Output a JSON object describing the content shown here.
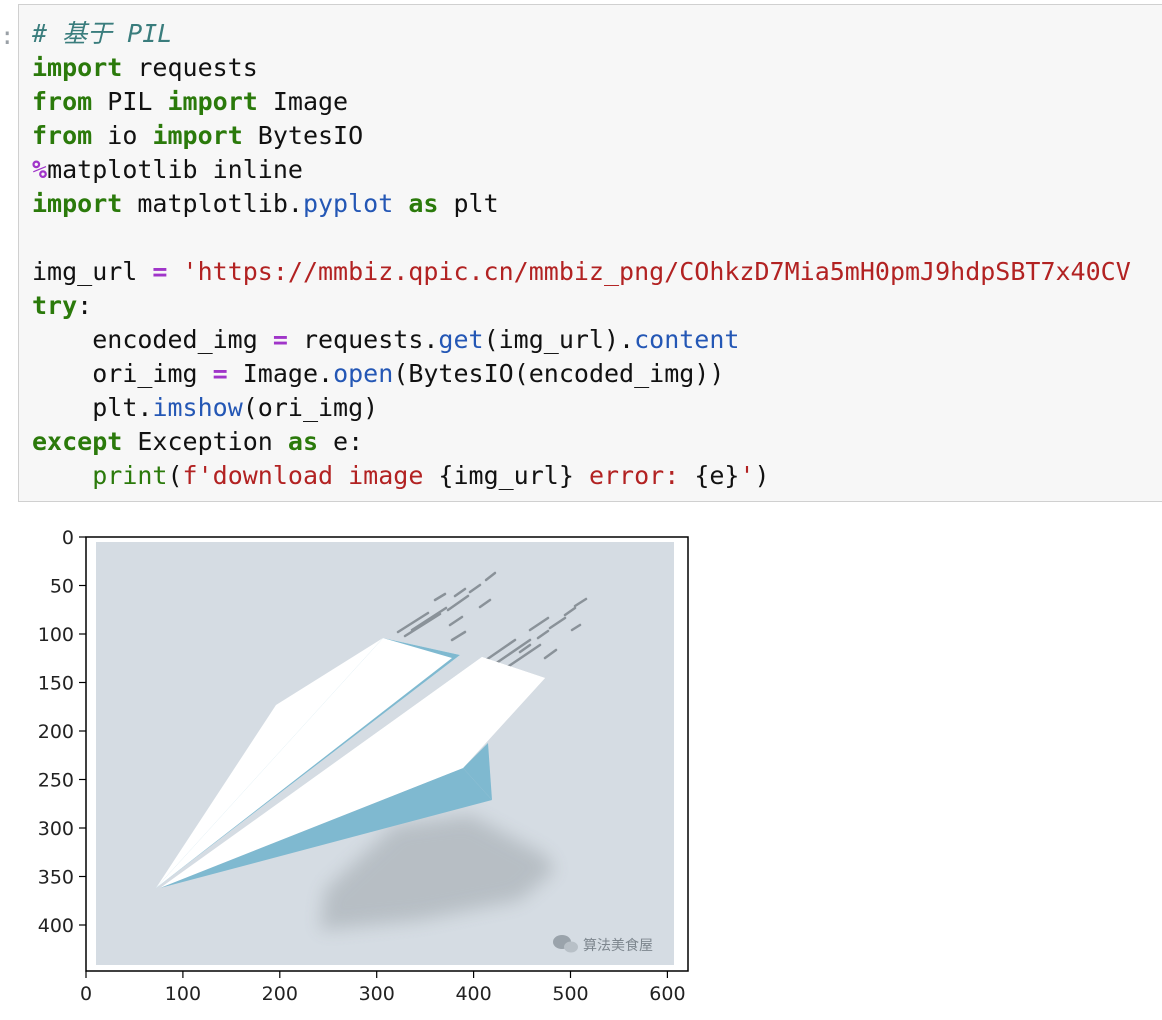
{
  "cell": {
    "prompt": ":",
    "code": {
      "comment": "# 基于 PIL",
      "kw_import": "import",
      "kw_from": "from",
      "kw_as": "as",
      "kw_try": "try",
      "kw_except": "except",
      "requests": " requests",
      "pil_mod": " PIL ",
      "image_cls": " Image",
      "io_mod": " io ",
      "bytesio": " BytesIO",
      "magic_sym": "%",
      "magic_rest": "matplotlib inline",
      "mpl_mod": " matplotlib.",
      "pyplot": "pyplot",
      "plt": " plt",
      "img_url_var": "img_url ",
      "eq": "=",
      "url_str": " 'https://mmbiz.qpic.cn/mmbiz_png/COhkzD7Mia5mH0pmJ9hdpSBT7x40CV",
      "colon": ":",
      "indent": "    ",
      "encoded_var": "encoded_img ",
      "requests_dot": " requests.",
      "get": "get",
      "get_args": "(img_url).",
      "content": "content",
      "ori_var": "ori_img ",
      "image_dot": " Image.",
      "open": "open",
      "open_args": "(BytesIO(encoded_img))",
      "plt_dot": "plt.",
      "imshow": "imshow",
      "imshow_args": "(ori_img)",
      "exception": " Exception ",
      "e_colon": " e:",
      "print": "print",
      "paren_open": "(",
      "fstr_a": "f'download image ",
      "brace_url": "{img_url}",
      "fstr_b": " error: ",
      "brace_e": "{e}",
      "fstr_c": "'",
      "paren_close": ")"
    }
  },
  "output": {
    "x_ticks": [
      "0",
      "100",
      "200",
      "300",
      "400",
      "500",
      "600"
    ],
    "y_ticks": [
      "0",
      "50",
      "100",
      "150",
      "200",
      "250",
      "300",
      "350",
      "400"
    ],
    "watermark": "算法美食屋"
  },
  "colors": {
    "keyword": "#2b7a0b",
    "string": "#b22222",
    "attribute": "#2457b5",
    "operator": "#a035c9",
    "comment": "#3a7d7d",
    "image_background": "#d5dce3",
    "plane_blue": "#7fb9d0"
  }
}
